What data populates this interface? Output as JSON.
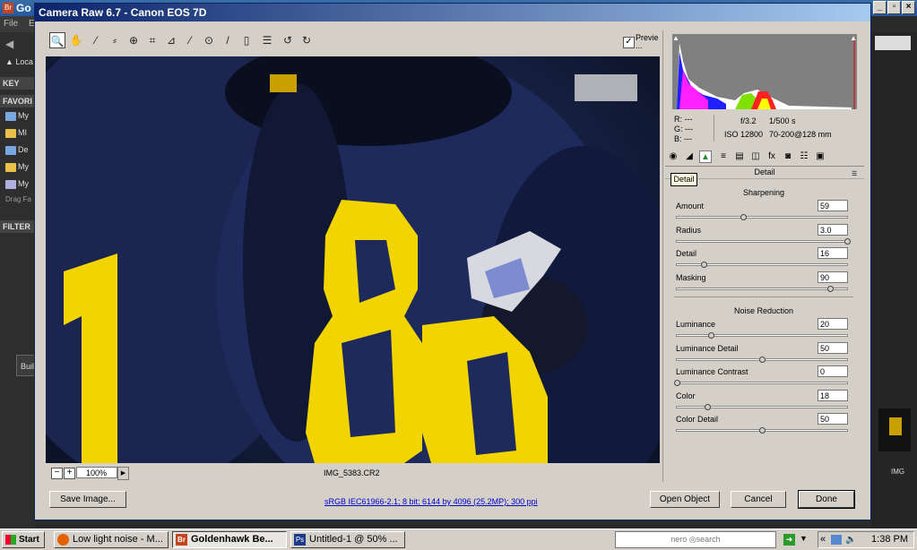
{
  "bridge": {
    "title_fragment": "Go",
    "menu": [
      "File",
      "E"
    ],
    "panels": {
      "keywords": "KEY",
      "favorites": "FAVORI",
      "filter": "FILTER"
    },
    "loc_label": "Loca",
    "favorites": [
      "My",
      "MI",
      "De",
      "My",
      "My"
    ],
    "drag_hint": "Drag Fa",
    "build_btn": "Buil",
    "thumb_label": "IMG"
  },
  "dialog": {
    "title": "Camera Raw 6.7  -  Canon EOS 7D",
    "preview_label": "Previe",
    "preview_checked": true,
    "tools": [
      "zoom-icon",
      "hand-icon",
      "white-balance-icon",
      "color-sampler-icon",
      "target-adjust-icon",
      "crop-icon",
      "straighten-icon",
      "spot-removal-icon",
      "red-eye-icon",
      "adjustment-brush-icon",
      "graduated-filter-icon",
      "preferences-icon",
      "rotate-ccw-icon",
      "rotate-cw-icon"
    ],
    "zoom_level": "100%",
    "zoom_minus": "−",
    "zoom_plus": "+",
    "filename": "IMG_5383.CR2",
    "readout": {
      "r": "R:",
      "g": "G:",
      "b": "B:",
      "r_val": "---",
      "g_val": "---",
      "b_val": "---",
      "aperture": "f/3.2",
      "shutter": "1/500 s",
      "iso": "ISO 12800",
      "lens": "70-200@128 mm"
    },
    "panel_title": "Detail",
    "tooltip": "Detail",
    "sharpening": {
      "title": "Sharpening",
      "sliders": [
        {
          "label": "Amount",
          "value": "59",
          "frac": 0.39
        },
        {
          "label": "Radius",
          "value": "3.0",
          "frac": 1.0
        },
        {
          "label": "Detail",
          "value": "16",
          "frac": 0.16
        },
        {
          "label": "Masking",
          "value": "90",
          "frac": 0.9
        }
      ]
    },
    "noise": {
      "title": "Noise Reduction",
      "sliders": [
        {
          "label": "Luminance",
          "value": "20",
          "frac": 0.2
        },
        {
          "label": "Luminance Detail",
          "value": "50",
          "frac": 0.5
        },
        {
          "label": "Luminance Contrast",
          "value": "0",
          "frac": 0.0
        },
        {
          "label": "Color",
          "value": "18",
          "frac": 0.18
        },
        {
          "label": "Color Detail",
          "value": "50",
          "frac": 0.5
        }
      ]
    },
    "save_button": "Save Image...",
    "workflow_link": "sRGB IEC61966-2.1; 8 bit; 6144 by 4096 (25.2MP); 300 ppi",
    "open_button": "Open Object",
    "cancel_button": "Cancel",
    "done_button": "Done",
    "jersey_text": "180"
  },
  "taskbar": {
    "start": "Start",
    "tasks": [
      {
        "label": "Low light noise - M...",
        "icon": "firefox-icon"
      },
      {
        "label": "Goldenhawk Be...",
        "icon": "bridge-icon",
        "active": true
      },
      {
        "label": "Untitled-1 @ 50% ...",
        "icon": "photoshop-icon"
      }
    ],
    "nero_text": "nero\nSEARCH",
    "clock": "1:38 PM",
    "tray_arrow": "«"
  }
}
